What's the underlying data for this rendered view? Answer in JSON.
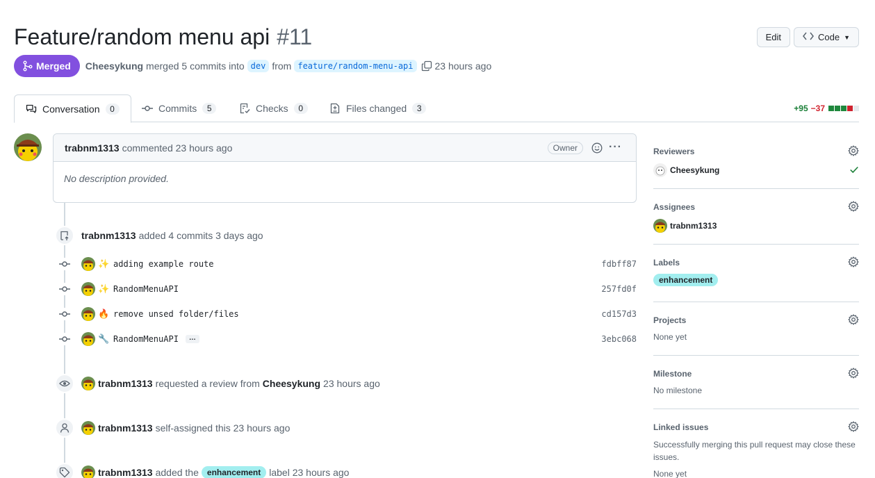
{
  "header": {
    "title": "Feature/random menu api",
    "number": "#11",
    "edit_label": "Edit",
    "code_label": "Code"
  },
  "meta": {
    "status": "Merged",
    "author": "Cheesykung",
    "action": "merged 5 commits into",
    "base_branch": "dev",
    "from_word": "from",
    "head_branch": "feature/random-menu-api",
    "time": "23 hours ago"
  },
  "tabs": [
    {
      "label": "Conversation",
      "count": "0"
    },
    {
      "label": "Commits",
      "count": "5"
    },
    {
      "label": "Checks",
      "count": "0"
    },
    {
      "label": "Files changed",
      "count": "3"
    }
  ],
  "diffstat": {
    "additions": "+95",
    "deletions": "−37"
  },
  "comment": {
    "author": "trabnm1313",
    "action": "commented 23 hours ago",
    "role": "Owner",
    "body": "No description provided."
  },
  "timeline": {
    "commits_event": {
      "author": "trabnm1313",
      "text": "added 4 commits 3 days ago"
    },
    "commits": [
      {
        "emoji": "✨",
        "message": "adding example route",
        "sha": "fdbff87"
      },
      {
        "emoji": "✨",
        "message": "RandomMenuAPI",
        "sha": "257fd0f"
      },
      {
        "emoji": "🔥",
        "message": "remove unsed folder/files",
        "sha": "cd157d3"
      },
      {
        "emoji": "🔧",
        "message": "RandomMenuAPI",
        "sha": "3ebc068",
        "more": "…"
      }
    ],
    "review_event": {
      "author": "trabnm1313",
      "text": "requested a review from",
      "reviewer": "Cheesykung",
      "time": "23 hours ago"
    },
    "assign_event": {
      "author": "trabnm1313",
      "text": "self-assigned this 23 hours ago"
    },
    "label_event": {
      "author": "trabnm1313",
      "text_before": "added the",
      "label": "enhancement",
      "text_after": "label 23 hours ago"
    }
  },
  "sidebar": {
    "reviewers": {
      "title": "Reviewers",
      "user": "Cheesykung"
    },
    "assignees": {
      "title": "Assignees",
      "user": "trabnm1313"
    },
    "labels": {
      "title": "Labels",
      "label": "enhancement"
    },
    "projects": {
      "title": "Projects",
      "value": "None yet"
    },
    "milestone": {
      "title": "Milestone",
      "value": "No milestone"
    },
    "linked": {
      "title": "Linked issues",
      "value": "Successfully merging this pull request may close these issues.",
      "value2": "None yet"
    }
  },
  "colors": {
    "merged": "#8250df",
    "label": "#a2eeef",
    "branch_bg": "#ddf4ff",
    "link": "#0969da"
  }
}
